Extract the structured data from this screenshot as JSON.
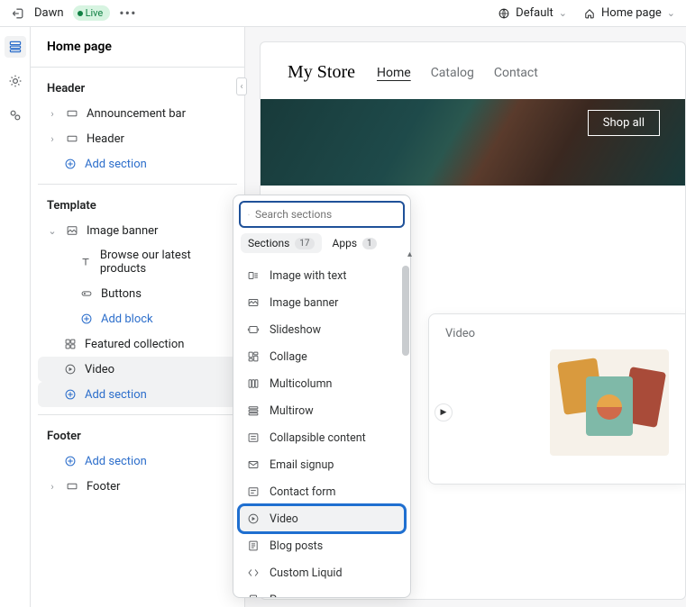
{
  "topbar": {
    "theme_name": "Dawn",
    "status_pill": "Live",
    "device_label": "Default",
    "page_label": "Home page"
  },
  "sidebar": {
    "title": "Home page",
    "groups": {
      "header": {
        "label": "Header",
        "items": [
          {
            "label": "Announcement bar"
          },
          {
            "label": "Header"
          }
        ],
        "add_label": "Add section"
      },
      "template": {
        "label": "Template",
        "items": [
          {
            "label": "Image banner",
            "expanded": true,
            "children": [
              {
                "label": "Browse our latest products"
              },
              {
                "label": "Buttons"
              }
            ],
            "add_block_label": "Add block"
          },
          {
            "label": "Featured collection"
          },
          {
            "label": "Video",
            "selected": true
          }
        ],
        "add_label": "Add section"
      },
      "footer": {
        "label": "Footer",
        "add_label": "Add section",
        "items": [
          {
            "label": "Footer"
          }
        ]
      }
    }
  },
  "canvas": {
    "store_name": "My Store",
    "nav": {
      "home": "Home",
      "catalog": "Catalog",
      "contact": "Contact"
    },
    "hero_button": "Shop all"
  },
  "popup": {
    "search_placeholder": "Search sections",
    "tabs": {
      "sections": {
        "label": "Sections",
        "count": "17"
      },
      "apps": {
        "label": "Apps",
        "count": "1"
      }
    },
    "items": [
      "Image with text",
      "Image banner",
      "Slideshow",
      "Collage",
      "Multicolumn",
      "Multirow",
      "Collapsible content",
      "Email signup",
      "Contact form",
      "Video",
      "Blog posts",
      "Custom Liquid",
      "Page"
    ],
    "highlighted": "Video"
  },
  "preview": {
    "title": "Video"
  }
}
